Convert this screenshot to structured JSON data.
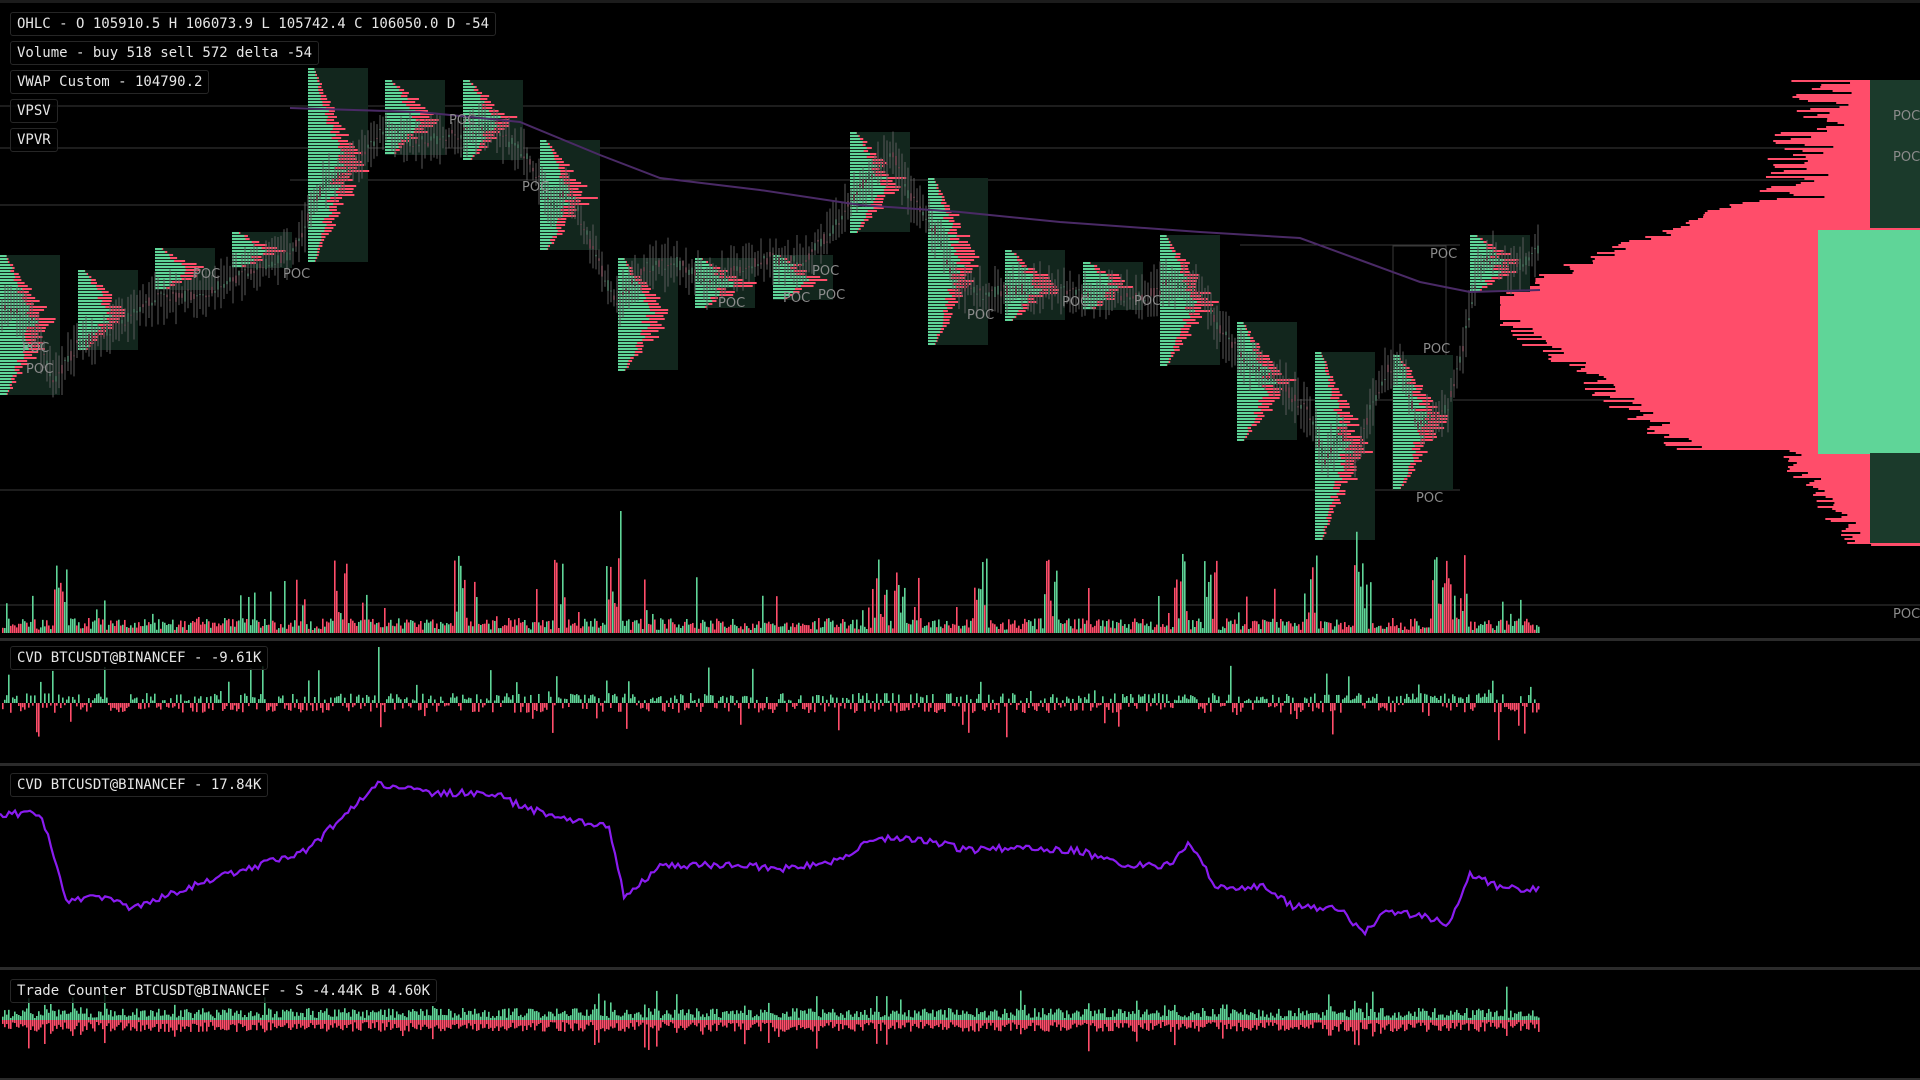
{
  "legends": {
    "ohlc": "OHLC - O 105910.5 H 106073.9 L 105742.4 C 106050.0 D -54",
    "volume": "Volume - buy 518 sell 572 delta -54",
    "vwap": "VWAP Custom - 104790.2",
    "vpsv": "VPSV",
    "vpvr": "VPVR",
    "cvd_delta": "CVD BTCUSDT@BINANCEF - -9.61K",
    "cvd": "CVD BTCUSDT@BINANCEF - 17.84K",
    "trades": "Trade Counter BTCUSDT@BINANCEF - S -4.44K B 4.60K"
  },
  "poc_label": "POC",
  "colors": {
    "background": "#000000",
    "buy": "#5fd598",
    "sell": "#ff4d6a",
    "vwap": "#4a2a66",
    "cvd_line": "#8a1cf0",
    "pane_separator": "#2b2b2b",
    "level_line": "#3a3a3a"
  },
  "chart_data": [
    {
      "type": "line",
      "title": "OHLC",
      "series": [
        {
          "name": "VWAP Custom",
          "values": [
            105400,
            105300,
            105250,
            105200,
            105150,
            105100,
            104980,
            104900,
            104860,
            104840,
            104820,
            104800,
            104790
          ]
        }
      ],
      "points": [
        {
          "x": 0.0,
          "y": 0.47
        },
        {
          "x": 0.02,
          "y": 0.5
        },
        {
          "x": 0.035,
          "y": 0.62
        },
        {
          "x": 0.05,
          "y": 0.55
        },
        {
          "x": 0.07,
          "y": 0.52
        },
        {
          "x": 0.1,
          "y": 0.46
        },
        {
          "x": 0.13,
          "y": 0.45
        },
        {
          "x": 0.16,
          "y": 0.41
        },
        {
          "x": 0.19,
          "y": 0.37
        },
        {
          "x": 0.21,
          "y": 0.24
        },
        {
          "x": 0.23,
          "y": 0.2
        },
        {
          "x": 0.25,
          "y": 0.13
        },
        {
          "x": 0.27,
          "y": 0.16
        },
        {
          "x": 0.3,
          "y": 0.14
        },
        {
          "x": 0.32,
          "y": 0.13
        },
        {
          "x": 0.34,
          "y": 0.18
        },
        {
          "x": 0.36,
          "y": 0.28
        },
        {
          "x": 0.37,
          "y": 0.25
        },
        {
          "x": 0.38,
          "y": 0.33
        },
        {
          "x": 0.4,
          "y": 0.47
        },
        {
          "x": 0.42,
          "y": 0.4
        },
        {
          "x": 0.44,
          "y": 0.39
        },
        {
          "x": 0.46,
          "y": 0.43
        },
        {
          "x": 0.48,
          "y": 0.4
        },
        {
          "x": 0.5,
          "y": 0.38
        },
        {
          "x": 0.52,
          "y": 0.39
        },
        {
          "x": 0.54,
          "y": 0.33
        },
        {
          "x": 0.56,
          "y": 0.24
        },
        {
          "x": 0.58,
          "y": 0.18
        },
        {
          "x": 0.59,
          "y": 0.26
        },
        {
          "x": 0.61,
          "y": 0.34
        },
        {
          "x": 0.62,
          "y": 0.43
        },
        {
          "x": 0.64,
          "y": 0.45
        },
        {
          "x": 0.66,
          "y": 0.44
        },
        {
          "x": 0.68,
          "y": 0.44
        },
        {
          "x": 0.7,
          "y": 0.45
        },
        {
          "x": 0.72,
          "y": 0.45
        },
        {
          "x": 0.74,
          "y": 0.46
        },
        {
          "x": 0.76,
          "y": 0.43
        },
        {
          "x": 0.78,
          "y": 0.44
        },
        {
          "x": 0.79,
          "y": 0.51
        },
        {
          "x": 0.81,
          "y": 0.58
        },
        {
          "x": 0.83,
          "y": 0.62
        },
        {
          "x": 0.85,
          "y": 0.68
        },
        {
          "x": 0.86,
          "y": 0.77
        },
        {
          "x": 0.87,
          "y": 0.72
        },
        {
          "x": 0.88,
          "y": 0.77
        },
        {
          "x": 0.89,
          "y": 0.67
        },
        {
          "x": 0.9,
          "y": 0.6
        },
        {
          "x": 0.91,
          "y": 0.58
        },
        {
          "x": 0.92,
          "y": 0.7
        },
        {
          "x": 0.93,
          "y": 0.69
        },
        {
          "x": 0.94,
          "y": 0.67
        },
        {
          "x": 0.95,
          "y": 0.55
        },
        {
          "x": 0.96,
          "y": 0.4
        },
        {
          "x": 0.97,
          "y": 0.38
        },
        {
          "x": 0.98,
          "y": 0.4
        },
        {
          "x": 0.99,
          "y": 0.39
        },
        {
          "x": 1.0,
          "y": 0.36
        }
      ]
    },
    {
      "type": "line",
      "title": "CVD BTCUSDT@BINANCEF",
      "points": [
        {
          "x": 0.0,
          "y": 0.22
        },
        {
          "x": 0.025,
          "y": 0.21
        },
        {
          "x": 0.03,
          "y": 0.31
        },
        {
          "x": 0.043,
          "y": 0.7
        },
        {
          "x": 0.07,
          "y": 0.67
        },
        {
          "x": 0.085,
          "y": 0.74
        },
        {
          "x": 0.11,
          "y": 0.66
        },
        {
          "x": 0.13,
          "y": 0.6
        },
        {
          "x": 0.16,
          "y": 0.52
        },
        {
          "x": 0.2,
          "y": 0.42
        },
        {
          "x": 0.22,
          "y": 0.25
        },
        {
          "x": 0.245,
          "y": 0.05
        },
        {
          "x": 0.28,
          "y": 0.1
        },
        {
          "x": 0.32,
          "y": 0.1
        },
        {
          "x": 0.34,
          "y": 0.18
        },
        {
          "x": 0.37,
          "y": 0.25
        },
        {
          "x": 0.395,
          "y": 0.28
        },
        {
          "x": 0.405,
          "y": 0.67
        },
        {
          "x": 0.43,
          "y": 0.5
        },
        {
          "x": 0.47,
          "y": 0.5
        },
        {
          "x": 0.51,
          "y": 0.52
        },
        {
          "x": 0.54,
          "y": 0.48
        },
        {
          "x": 0.57,
          "y": 0.35
        },
        {
          "x": 0.6,
          "y": 0.36
        },
        {
          "x": 0.63,
          "y": 0.42
        },
        {
          "x": 0.66,
          "y": 0.4
        },
        {
          "x": 0.7,
          "y": 0.42
        },
        {
          "x": 0.73,
          "y": 0.5
        },
        {
          "x": 0.76,
          "y": 0.5
        },
        {
          "x": 0.772,
          "y": 0.38
        },
        {
          "x": 0.79,
          "y": 0.62
        },
        {
          "x": 0.82,
          "y": 0.62
        },
        {
          "x": 0.84,
          "y": 0.73
        },
        {
          "x": 0.87,
          "y": 0.74
        },
        {
          "x": 0.885,
          "y": 0.88
        },
        {
          "x": 0.9,
          "y": 0.76
        },
        {
          "x": 0.925,
          "y": 0.78
        },
        {
          "x": 0.94,
          "y": 0.84
        },
        {
          "x": 0.955,
          "y": 0.55
        },
        {
          "x": 0.975,
          "y": 0.63
        },
        {
          "x": 1.0,
          "y": 0.63
        }
      ]
    },
    {
      "type": "bar",
      "title": "Volume - buy 518 sell 572 delta -54"
    },
    {
      "type": "bar",
      "title": "CVD BTCUSDT@BINANCEF - -9.61K"
    },
    {
      "type": "bar",
      "title": "Trade Counter BTCUSDT@BINANCEF - S -4.44K B 4.60K"
    }
  ]
}
